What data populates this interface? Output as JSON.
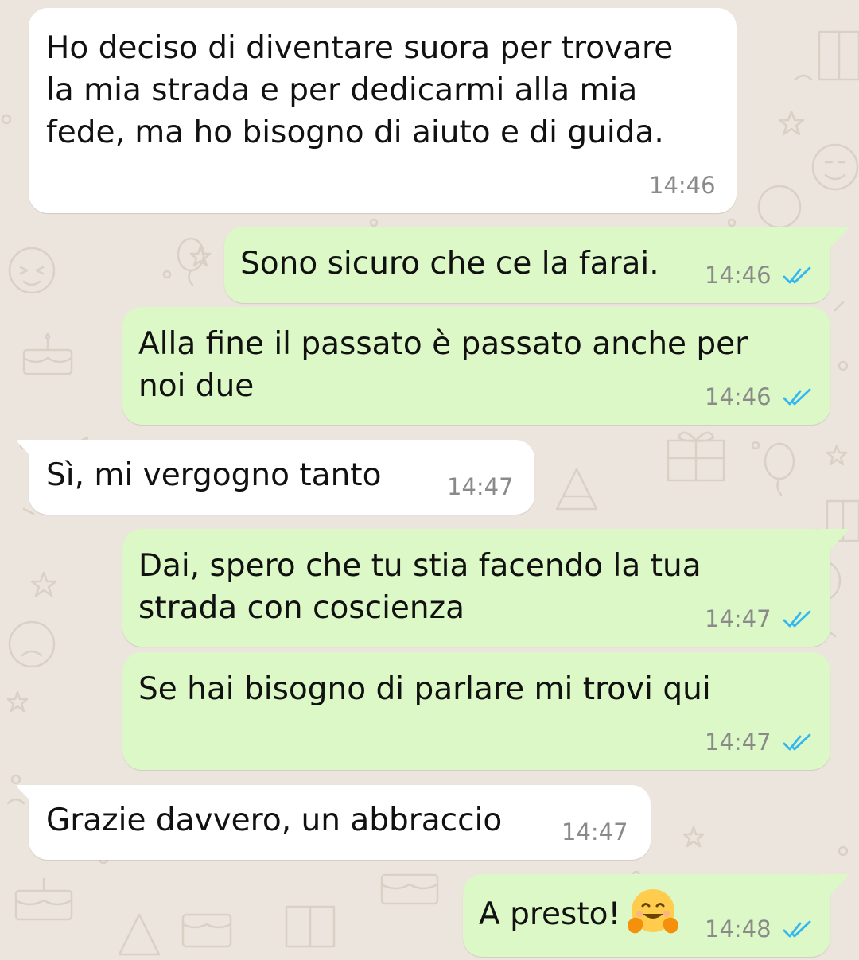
{
  "chat": {
    "messages": [
      {
        "direction": "incoming",
        "lines": [
          "Ho deciso di diventare suora per trovare",
          "la mia strada e per dedicarmi alla mia",
          "fede, ma ho bisogno di aiuto e di guida."
        ],
        "time": "14:46"
      },
      {
        "direction": "outgoing",
        "lines": [
          "Sono sicuro che ce la farai."
        ],
        "time": "14:46",
        "status": "read"
      },
      {
        "direction": "outgoing",
        "lines": [
          "Alla fine il passato è passato anche per",
          "noi due"
        ],
        "time": "14:46",
        "status": "read"
      },
      {
        "direction": "incoming",
        "lines": [
          "Sì, mi vergogno tanto"
        ],
        "time": "14:47"
      },
      {
        "direction": "outgoing",
        "lines": [
          "Dai, spero che tu stia facendo la tua",
          "strada con coscienza"
        ],
        "time": "14:47",
        "status": "read"
      },
      {
        "direction": "outgoing",
        "lines": [
          "Se hai bisogno di parlare mi trovi qui"
        ],
        "time": "14:47",
        "status": "read"
      },
      {
        "direction": "incoming",
        "lines": [
          "Grazie davvero, un abbraccio"
        ],
        "time": "14:47"
      },
      {
        "direction": "outgoing",
        "lines": [
          "A presto!"
        ],
        "emoji": "hugging-face-emoji",
        "time": "14:48",
        "status": "read"
      }
    ]
  },
  "colors": {
    "background": "#ECE5DD",
    "incoming_bubble": "#FFFFFF",
    "outgoing_bubble": "#DCF8C6",
    "read_ticks": "#34B7F1",
    "timestamp": "#8A8A8A"
  }
}
